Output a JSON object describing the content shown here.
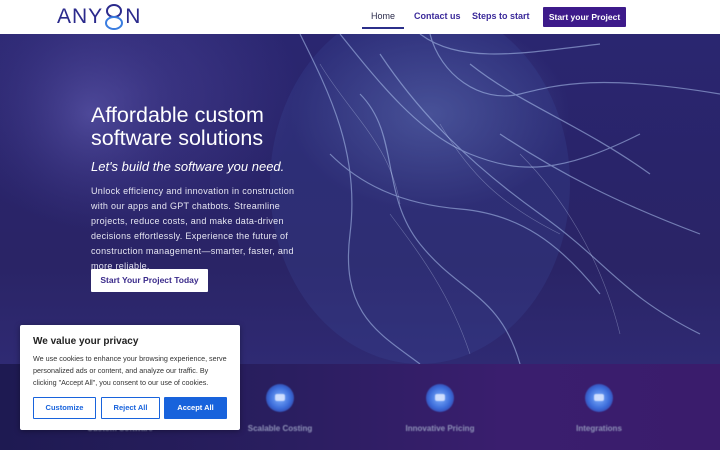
{
  "header": {
    "logo_text_left": "ANY",
    "logo_text_right": "N",
    "nav": {
      "home": "Home",
      "contact": "Contact us",
      "steps": "Steps to start"
    },
    "cta_label": "Start your Project"
  },
  "hero": {
    "title": "Affordable custom software solutions",
    "subtitle": "Let's build the software you need.",
    "body": "Unlock efficiency and innovation in construction with our apps and GPT chatbots. Streamline projects, reduce costs, and make data-driven decisions effortlessly. Experience the future of construction management—smarter, faster, and more reliable.",
    "button_label": "Start Your Project Today"
  },
  "features": [
    {
      "label": "Custom Software",
      "icon": "code-icon"
    },
    {
      "label": "Scalable Costing",
      "icon": "chart-icon"
    },
    {
      "label": "Innovative Pricing",
      "icon": "lightbulb-icon"
    },
    {
      "label": "Integrations",
      "icon": "plug-icon"
    }
  ],
  "cookie": {
    "title": "We value your privacy",
    "text": "We use cookies to enhance your browsing experience, serve personalized ads or content, and analyze our traffic. By clicking \"Accept All\", you consent to our use of cookies.",
    "customize": "Customize",
    "reject": "Reject All",
    "accept": "Accept All"
  },
  "colors": {
    "brand": "#2b2a8c",
    "cta": "#3d1a8a",
    "cookie_accent": "#1863dc"
  }
}
